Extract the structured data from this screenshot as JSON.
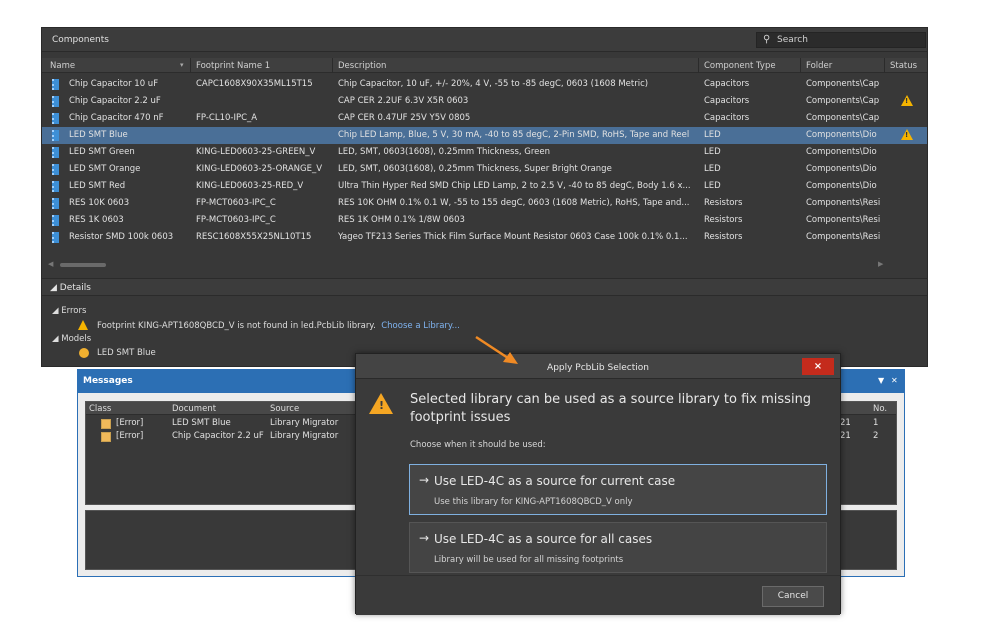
{
  "components": {
    "title": "Components",
    "search_placeholder": "Search",
    "columns": [
      "Name",
      "Footprint Name 1",
      "Description",
      "Component Type",
      "Folder",
      "Status"
    ],
    "rows": [
      {
        "name": "Chip Capacitor 10 uF",
        "footprint": "CAPC1608X90X35ML15T15",
        "description": "Chip Capacitor, 10 uF, +/- 20%, 4 V, -55 to -85 degC, 0603 (1608 Metric)",
        "type": "Capacitors",
        "folder": "Components\\Cap",
        "warning": false
      },
      {
        "name": "Chip Capacitor 2.2 uF",
        "footprint": "",
        "description": "CAP CER 2.2UF 6.3V X5R 0603",
        "type": "Capacitors",
        "folder": "Components\\Cap",
        "warning": true
      },
      {
        "name": "Chip Capacitor 470 nF",
        "footprint": "FP-CL10-IPC_A",
        "description": "CAP CER 0.47UF 25V Y5V 0805",
        "type": "Capacitors",
        "folder": "Components\\Cap",
        "warning": false
      },
      {
        "name": "LED SMT Blue",
        "footprint": "",
        "description": "Chip LED Lamp, Blue, 5 V, 30 mA, -40 to 85 degC, 2-Pin SMD, RoHS, Tape and Reel",
        "type": "LED",
        "folder": "Components\\Dio",
        "warning": true,
        "selected": true
      },
      {
        "name": "LED SMT Green",
        "footprint": "KING-LED0603-25-GREEN_V",
        "description": "LED, SMT, 0603(1608), 0.25mm Thickness, Green",
        "type": "LED",
        "folder": "Components\\Dio",
        "warning": false
      },
      {
        "name": "LED SMT Orange",
        "footprint": "KING-LED0603-25-ORANGE_V",
        "description": "LED, SMT, 0603(1608), 0.25mm Thickness, Super Bright Orange",
        "type": "LED",
        "folder": "Components\\Dio",
        "warning": false
      },
      {
        "name": "LED SMT Red",
        "footprint": "KING-LED0603-25-RED_V",
        "description": "Ultra Thin Hyper Red SMD Chip LED Lamp, 2 to 2.5 V, -40 to 85 degC, Body 1.6 x...",
        "type": "LED",
        "folder": "Components\\Dio",
        "warning": false
      },
      {
        "name": "RES 10K 0603",
        "footprint": "FP-MCT0603-IPC_C",
        "description": "RES 10K OHM 0.1% 0.1 W, -55 to 155 degC, 0603 (1608 Metric), RoHS, Tape and...",
        "type": "Resistors",
        "folder": "Components\\Resi",
        "warning": false
      },
      {
        "name": "RES 1K 0603",
        "footprint": "FP-MCT0603-IPC_C",
        "description": "RES 1K OHM 0.1% 1/8W 0603",
        "type": "Resistors",
        "folder": "Components\\Resi",
        "warning": false
      },
      {
        "name": "Resistor SMD 100k 0603",
        "footprint": "RESC1608X55X25NL10T15",
        "description": "Yageo TF213 Series Thick Film Surface Mount Resistor 0603 Case 100k 0.1% 0.1...",
        "type": "Resistors",
        "folder": "Components\\Resi",
        "warning": false
      }
    ],
    "details_label": "Details",
    "errors_label": "Errors",
    "error_text": "Footprint KING-APT1608QBCD_V is not found in led.PcbLib library.",
    "error_link": "Choose a Library...",
    "models_label": "Models",
    "model_item": "LED SMT Blue"
  },
  "messages": {
    "title": "Messages",
    "columns": [
      "Class",
      "Document",
      "Source",
      "No."
    ],
    "rows": [
      {
        "class": "[Error]",
        "document": "LED SMT Blue",
        "source": "Library Migrator",
        "date_tail": "21",
        "no": "1"
      },
      {
        "class": "[Error]",
        "document": "Chip Capacitor 2.2 uF",
        "source": "Library Migrator",
        "date_tail": "21",
        "no": "2"
      }
    ]
  },
  "dialog": {
    "title": "Apply PcbLib Selection",
    "close": "×",
    "message": "Selected library can be used as a source library to fix missing footprint issues",
    "sub": "Choose when it should be used:",
    "option1_head": "Use LED-4C as a source for current case",
    "option1_desc": "Use this library for KING-APT1608QBCD_V only",
    "option2_head": "Use LED-4C as a source for all cases",
    "option2_desc": "Library will be used for all missing footprints",
    "cancel": "Cancel"
  },
  "colors": {
    "accent": "#2c6fb4",
    "selection": "#4a6f97",
    "warning": "#f5b400",
    "callout": "#f08a24"
  }
}
